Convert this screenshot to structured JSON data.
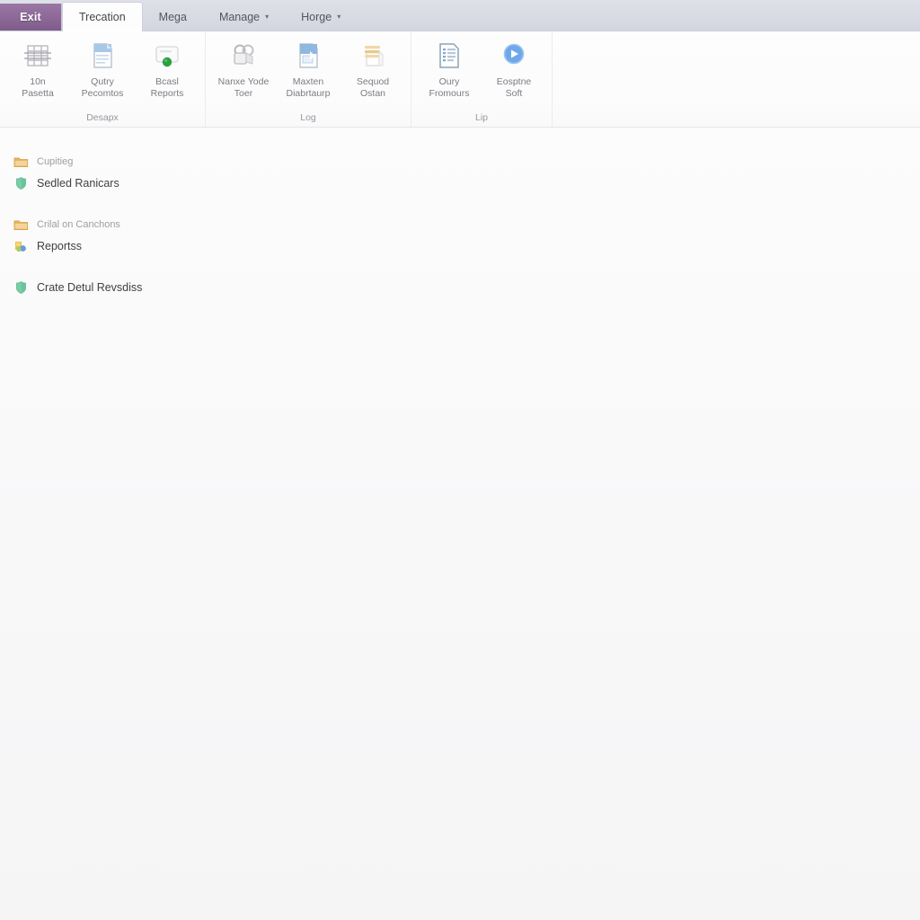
{
  "window": {
    "background_color": "#fbfbfb"
  },
  "tabstrip": {
    "background_color": "#d8dae4",
    "file_tab": {
      "label": "Exit",
      "color": "#8c6897",
      "icon": "file-menu"
    },
    "tabs": [
      {
        "label": "Trecation",
        "active": true,
        "has_caret": false
      },
      {
        "label": "Mega",
        "active": false,
        "has_caret": false
      },
      {
        "label": "Manage",
        "active": false,
        "has_caret": true,
        "caret": "▾"
      },
      {
        "label": "Horge",
        "active": false,
        "has_caret": true,
        "caret": "▾"
      }
    ]
  },
  "ribbon": {
    "groups": [
      {
        "title": "Desapx",
        "items": [
          {
            "label_line1": "10n",
            "label_line2": "Pasetta",
            "icon": "table-grid-icon"
          },
          {
            "label_line1": "Qutry",
            "label_line2": "Pecomtos",
            "icon": "blue-document-icon"
          },
          {
            "label_line1": "Bcasl",
            "label_line2": "Reports",
            "icon": "window-green-badge-icon"
          }
        ]
      },
      {
        "title": "Log",
        "items": [
          {
            "label_line1": "Nanxe Yode",
            "label_line2": "Toer",
            "icon": "lock-rings-icon"
          },
          {
            "label_line1": "Maxten",
            "label_line2": "Diabrtaurp",
            "icon": "blue-page-arrow-icon"
          },
          {
            "label_line1": "Sequod",
            "label_line2": "Ostan",
            "icon": "amber-stack-icon"
          }
        ]
      },
      {
        "title": "Lip",
        "items": [
          {
            "label_line1": "Oury",
            "label_line2": "Fromours",
            "icon": "list-document-icon"
          },
          {
            "label_line1": "Eosptne",
            "label_line2": "Soft",
            "icon": "play-circle-icon"
          }
        ]
      }
    ]
  },
  "content": {
    "groups": [
      {
        "rows": [
          {
            "text": "Cupitieg",
            "icon": "folder-icon",
            "muted": true
          },
          {
            "text": "Sedled Ranicars",
            "icon": "green-shield-icon",
            "muted": false
          }
        ]
      },
      {
        "rows": [
          {
            "text": "Crilal on Canchons",
            "icon": "folder-icon",
            "muted": true
          },
          {
            "text": "Reportss",
            "icon": "report-chart-icon",
            "muted": false
          }
        ]
      },
      {
        "rows": [
          {
            "text": "Crate Detul Revsdiss",
            "icon": "green-shield-icon",
            "muted": false
          }
        ]
      }
    ]
  },
  "colors": {
    "accent_purple": "#8c6897",
    "folder_amber": "#e8b560",
    "shield_green": "#6cc39a",
    "badge_green": "#29a13f",
    "play_blue": "#6fa8e8",
    "document_blue": "#9dc3e6",
    "stack_amber": "#e8c98a"
  }
}
